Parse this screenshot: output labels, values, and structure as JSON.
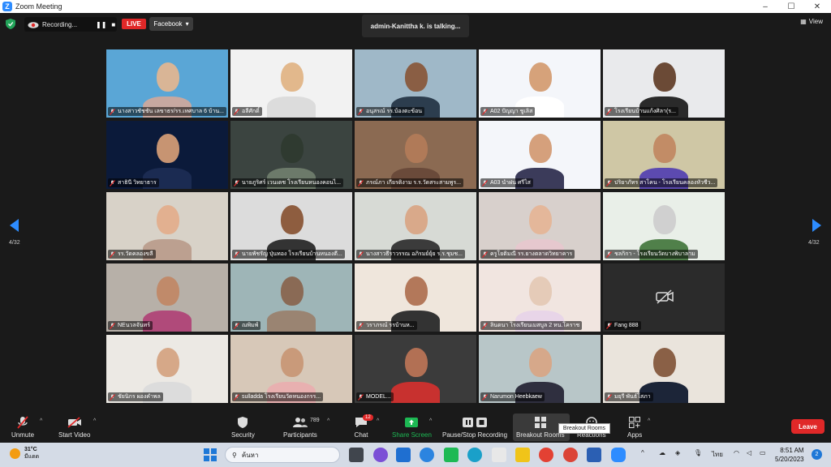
{
  "window": {
    "title": "Zoom Meeting",
    "minimize": "–",
    "maximize": "☐",
    "close": "✕"
  },
  "topbar": {
    "recording_label": "Recording...",
    "pause_icon": "pause-icon",
    "stop_icon": "stop-icon",
    "live_label": "LIVE",
    "stream_target": "Facebook",
    "talking_banner": "admin-Kanittha k. is talking...",
    "view_label": "View"
  },
  "gallery": {
    "page_indicator": "4/32",
    "tiles": [
      {
        "name": "นางสาวชัชชัน  เลขาธร/รร.เทศบาล 6 บ้าน..."
      },
      {
        "name": "อลีศักดิ์"
      },
      {
        "name": "อนุสรณ์ รร.บ้องตะข้อน"
      },
      {
        "name": "A02 ปัญญา ชูเลิส"
      },
      {
        "name": "โรงเรียนบ้านแก้งศิลา(ร..."
      },
      {
        "name": "สาธินี วิทยาธาร"
      },
      {
        "name": "นายภูริศร์  เวนเดช  โรงเรียนหนองคอนไ..."
      },
      {
        "name": "ภรณ์ภา เกียรติงาม  ร.ร.วัดสระสามพูร..."
      },
      {
        "name": "A03 นำฝน ศรีไส"
      },
      {
        "name": "ปริยาภัทร สาโคน - โรงเรียนคลองหัวชีว..."
      },
      {
        "name": "รร.วัดคลองขลี"
      },
      {
        "name": "นายพัชรัญ ปุ่นทอง  โรงเรียนบ้านหนองตี..."
      },
      {
        "name": "นางสาวธีราวรรณ  อภิรมย์ยุ้ย  ร.ร.ชุมช..."
      },
      {
        "name": "ครูโยติมณี รร.ยางตลาดวิทยาคาร"
      },
      {
        "name": "ชลกิกา - โรงเรียนวัดบางพิบาลาม"
      },
      {
        "name": "NEนวลจันทร์"
      },
      {
        "name": "ณพิมพ์"
      },
      {
        "name": "วราภรณ์ รรบ้านห..."
      },
      {
        "name": "ลินดนา โรงเรียนเมสบูล 2 หน.โคราช"
      },
      {
        "name": "Fang 888"
      },
      {
        "name": "ชัยนิกร ผองคำพล"
      },
      {
        "name": "sulladda  โรงเรียนวัดหนองกรร..."
      },
      {
        "name": "MODEL..."
      },
      {
        "name": "Narumon  Heebkaew"
      },
      {
        "name": "มยุรี พันธ์โสภา"
      }
    ]
  },
  "toolbar": {
    "unmute": "Unmute",
    "start_video": "Start Video",
    "security": "Security",
    "participants": "Participants",
    "participants_count": "789",
    "chat": "Chat",
    "chat_badge": "12",
    "share_screen": "Share Screen",
    "pause_stop_recording": "Pause/Stop Recording",
    "breakout_rooms": "Breakout Rooms",
    "breakout_tooltip": "Breakout Rooms",
    "reactions": "Reactions",
    "apps": "Apps",
    "leave": "Leave"
  },
  "taskbar": {
    "temperature": "31°C",
    "weather_text": "มีแดด",
    "search_placeholder": "ค้นหา",
    "language": "ไทย",
    "time": "8:51 AM",
    "date": "5/20/2023",
    "notification_count": "2"
  },
  "colors": {
    "live_red": "#e02828",
    "zoom_blue": "#2d8cff",
    "share_green": "#1db954",
    "nav_blue": "#2d8cff"
  }
}
